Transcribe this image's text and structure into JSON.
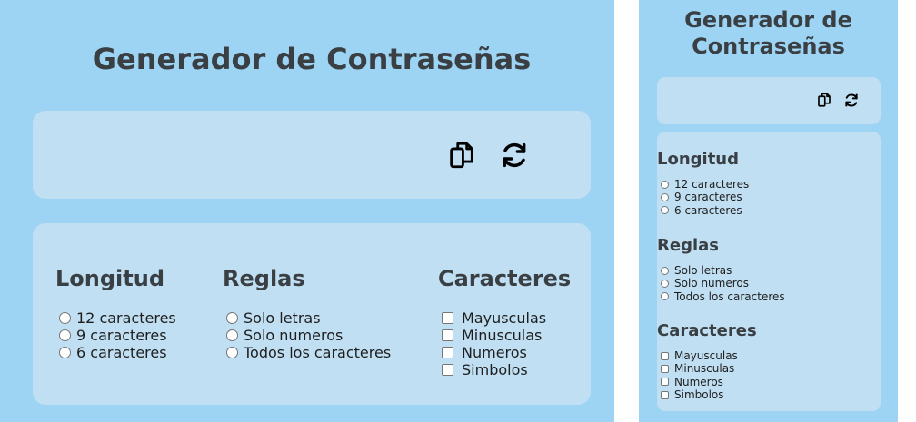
{
  "title": "Generador de Contraseñas",
  "icons": {
    "copy": "copy-icon",
    "regenerate": "refresh-icon"
  },
  "groups": {
    "length": {
      "title": "Longitud",
      "options": [
        "12 caracteres",
        "9 caracteres",
        "6 caracteres"
      ]
    },
    "rules": {
      "title": "Reglas",
      "options": [
        "Solo letras",
        "Solo numeros",
        "Todos los caracteres"
      ]
    },
    "chars": {
      "title": "Caracteres",
      "options": [
        "Mayusculas",
        "Minusculas",
        "Numeros",
        "Simbolos"
      ]
    }
  },
  "colors": {
    "background": "#9dd4f3",
    "card": "#c0dff2",
    "heading": "#3a3f44"
  }
}
